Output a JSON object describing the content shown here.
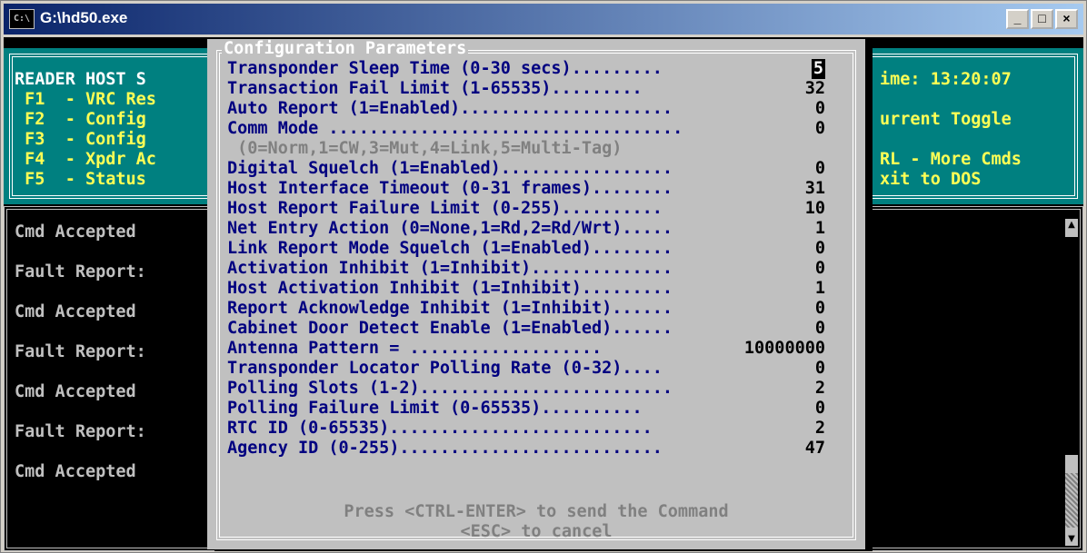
{
  "window": {
    "title": "G:\\hd50.exe",
    "icon": "C:\\",
    "buttons": [
      "_",
      "□",
      "×"
    ]
  },
  "header": {
    "left_lines": [
      "READER HOST S",
      " F1  - VRC Res",
      " F2  - Config",
      " F3  - Config",
      " F4  - Xpdr Ac",
      " F5  - Status"
    ],
    "right_lines": [
      "ime: 13:20:07",
      "",
      "urrent Toggle",
      "",
      "RL - More Cmds",
      "xit to DOS"
    ]
  },
  "log": {
    "lines": [
      "Cmd Accepted",
      "Fault Report:",
      "Cmd Accepted",
      "Fault Report:",
      "Cmd Accepted",
      "Fault Report:",
      "Cmd Accepted"
    ]
  },
  "dialog": {
    "title": "Configuration Parameters",
    "params": [
      {
        "label": "Transponder Sleep Time (0-30 secs).........",
        "value": "5",
        "selected": true
      },
      {
        "label": "Transaction Fail Limit (1-65535).........",
        "value": "32"
      },
      {
        "label": "Auto Report (1=Enabled).....................",
        "value": "0"
      },
      {
        "label": "Comm Mode ...................................",
        "value": "0"
      },
      {
        "label": " (0=Norm,1=CW,3=Mut,4=Link,5=Multi-Tag)",
        "value": "",
        "dim": true
      },
      {
        "label": "Digital Squelch (1=Enabled).................",
        "value": "0"
      },
      {
        "label": "Host Interface Timeout (0-31 frames)........",
        "value": "31"
      },
      {
        "label": "Host Report Failure Limit (0-255)..........",
        "value": "10"
      },
      {
        "label": "Net Entry Action (0=None,1=Rd,2=Rd/Wrt).....",
        "value": "1"
      },
      {
        "label": "Link Report Mode Squelch (1=Enabled)........",
        "value": "0"
      },
      {
        "label": "Activation Inhibit (1=Inhibit)..............",
        "value": "0"
      },
      {
        "label": "Host Activation Inhibit (1=Inhibit).........",
        "value": "1"
      },
      {
        "label": "Report Acknowledge Inhibit (1=Inhibit)......",
        "value": "0"
      },
      {
        "label": "Cabinet Door Detect Enable (1=Enabled)......",
        "value": "0"
      },
      {
        "label": "Antenna Pattern = ...................",
        "value": "10000000"
      },
      {
        "label": "Transponder Locator Polling Rate (0-32)....",
        "value": "0"
      },
      {
        "label": "Polling Slots (1-2).........................",
        "value": "2"
      },
      {
        "label": "Polling Failure Limit (0-65535)..........",
        "value": "0"
      },
      {
        "label": "RTC ID (0-65535)..........................",
        "value": "2"
      },
      {
        "label": "Agency ID (0-255)..........................",
        "value": "47"
      }
    ],
    "footer": [
      "Press <CTRL-ENTER> to send the Command",
      "<ESC> to cancel"
    ]
  }
}
